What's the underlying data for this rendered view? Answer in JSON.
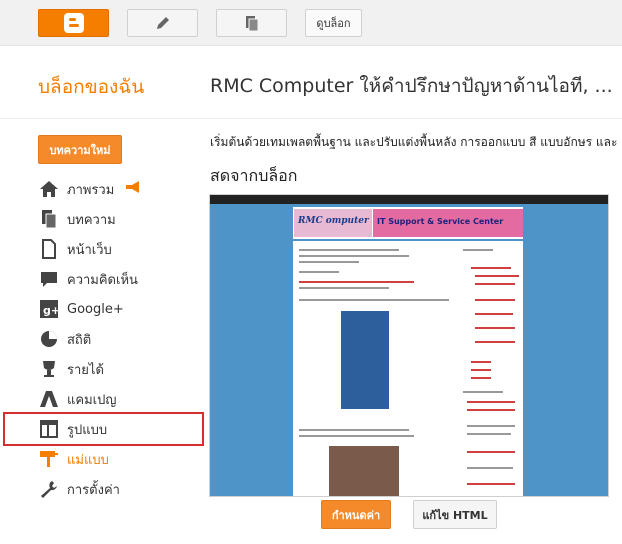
{
  "topbar": {
    "view_blog_label": "ดูบล็อก"
  },
  "header": {
    "my_blog": "บล็อกของฉัน",
    "blog_title": "RMC Computer ให้คำปรึกษาปัญหาด้านไอที, ..."
  },
  "sidebar": {
    "new_post_label": "บทความใหม่",
    "items": [
      {
        "label": "ภาพรวม",
        "icon": "home-icon"
      },
      {
        "label": "บทความ",
        "icon": "posts-icon"
      },
      {
        "label": "หน้าเว็บ",
        "icon": "pages-icon"
      },
      {
        "label": "ความคิดเห็น",
        "icon": "comments-icon"
      },
      {
        "label": "Google+",
        "icon": "google-plus-icon"
      },
      {
        "label": "สถิติ",
        "icon": "stats-icon"
      },
      {
        "label": "รายได้",
        "icon": "earnings-icon"
      },
      {
        "label": "แคมเปญ",
        "icon": "campaigns-icon"
      },
      {
        "label": "รูปแบบ",
        "icon": "layout-icon"
      },
      {
        "label": "แม่แบบ",
        "icon": "template-icon"
      },
      {
        "label": "การตั้งค่า",
        "icon": "settings-icon"
      }
    ]
  },
  "main": {
    "intro": "เริ่มต้นด้วยเทมเพลตพื้นฐาน และปรับแต่งพื้นหลัง การออกแบบ สี แบบอักษร และ",
    "live_label": "สดจากบล็อก",
    "preview_banner": "IT Support & Service Center",
    "preview_logo": "RMC omputer",
    "customize_label": "กำหนดค่า",
    "edit_html_label": "แก้ไข HTML"
  },
  "colors": {
    "accent": "#f57d00",
    "highlight": "#d32f2f"
  }
}
